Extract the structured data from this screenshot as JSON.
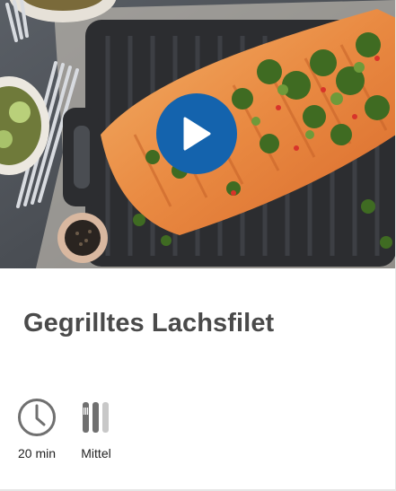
{
  "recipe": {
    "title": "Gegrilltes Lachsfilet",
    "media": {
      "type": "video",
      "play_icon": "play-icon"
    },
    "meta": {
      "time": {
        "icon": "clock-icon",
        "label": "20 min"
      },
      "difficulty": {
        "icon": "difficulty-bars-icon",
        "label": "Mittel",
        "level": 2,
        "max_level": 3
      }
    }
  },
  "colors": {
    "play_button": "#1463ad",
    "title_text": "#4a4a4a",
    "icon_gray": "#707070"
  }
}
